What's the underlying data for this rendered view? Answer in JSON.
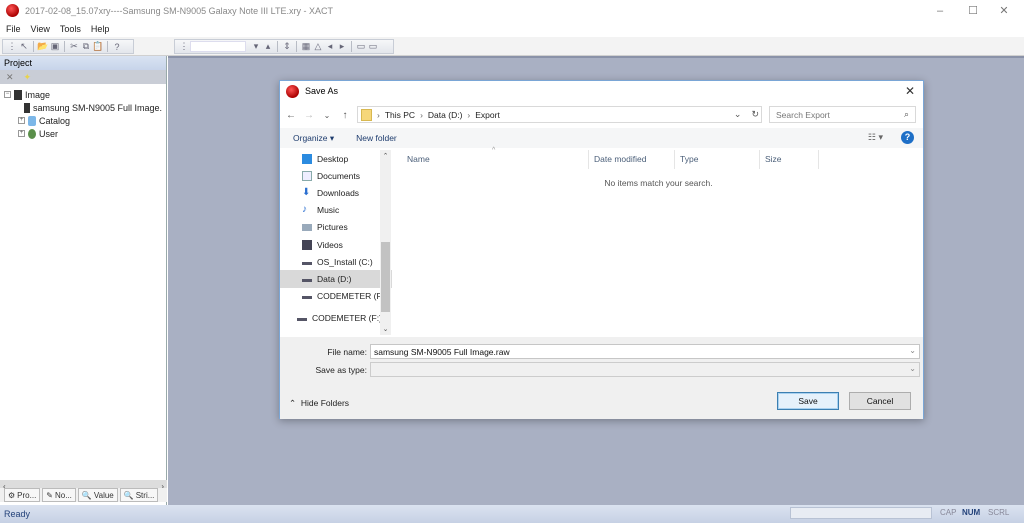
{
  "window": {
    "title": "2017-02-08_15.07xry----Samsung SM-N9005 Galaxy Note III LTE.xry - XACT",
    "controls": {
      "minimize": "–",
      "maximize": "☐",
      "close": "✕"
    }
  },
  "menu": [
    "File",
    "View",
    "Tools",
    "Help"
  ],
  "left_panel": {
    "title": "Project",
    "tree": [
      {
        "label": "Image",
        "expander": "⊟",
        "icon": "image-icon"
      },
      {
        "label": "samsung SM-N9005 Full Image.",
        "icon": "image-file-icon"
      },
      {
        "label": "Catalog",
        "expander": "⊞",
        "icon": "catalog-icon"
      },
      {
        "label": "User",
        "expander": "⊞",
        "icon": "user-icon"
      }
    ],
    "bottom_tabs": [
      "Pro...",
      "No...",
      "Value",
      "Stri..."
    ]
  },
  "status": {
    "text": "Ready",
    "indicators": [
      "CAP",
      "NUM",
      "SCRL"
    ]
  },
  "dialog": {
    "title": "Save As",
    "breadcrumb": [
      "This PC",
      "Data (D:)",
      "Export"
    ],
    "search_placeholder": "Search Export",
    "organize": "Organize ▾",
    "new_folder": "New folder",
    "nav_items": [
      {
        "label": "Desktop",
        "icon": "desktop-icon"
      },
      {
        "label": "Documents",
        "icon": "documents-icon"
      },
      {
        "label": "Downloads",
        "icon": "downloads-icon"
      },
      {
        "label": "Music",
        "icon": "music-icon"
      },
      {
        "label": "Pictures",
        "icon": "pictures-icon"
      },
      {
        "label": "Videos",
        "icon": "videos-icon"
      },
      {
        "label": "OS_Install (C:)",
        "icon": "drive-icon"
      },
      {
        "label": "Data (D:)",
        "icon": "drive-icon",
        "selected": true
      },
      {
        "label": "CODEMETER (F:)",
        "icon": "drive-icon"
      },
      {
        "label": "CODEMETER (F:)",
        "icon": "drive-icon"
      }
    ],
    "columns": [
      "Name",
      "Date modified",
      "Type",
      "Size"
    ],
    "empty_message": "No items match your search.",
    "file_name_label": "File name:",
    "file_name_value": "samsung SM-N9005 Full Image.raw",
    "save_type_label": "Save as type:",
    "save_type_value": "",
    "hide_folders": "Hide Folders",
    "save_button": "Save",
    "cancel_button": "Cancel"
  }
}
